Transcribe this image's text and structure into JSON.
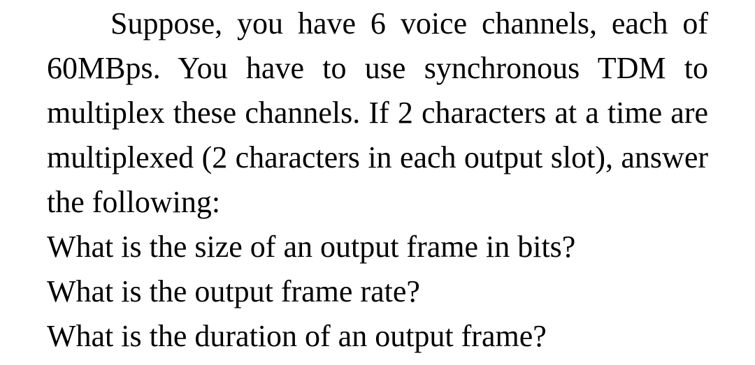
{
  "document": {
    "background_color": "#ffffff",
    "text_color": "#000000",
    "body": {
      "problem_statement": "Suppose, you have 6 voice channels, each of 60MBps. You have to use synchronous TDM to multiplex these channels. If 2 characters at a time are multiplexed (2 characters in each output slot), answer the following:",
      "questions": [
        "What is the size of an output frame in bits?",
        "What is the output frame rate?",
        "What is the duration of an output frame?"
      ]
    },
    "rendered_lines": [
      "Suppose, you have 6 voice channels, each",
      "of 60MBps. You have to use synchronous TDM",
      "to multiplex these channels. If 2 characters at a",
      "time are multiplexed (2 characters in each",
      "output slot), answer the following:",
      "What is the size of an output frame in bits?",
      "What is the output frame rate?",
      "What is the duration of an output frame?"
    ]
  }
}
